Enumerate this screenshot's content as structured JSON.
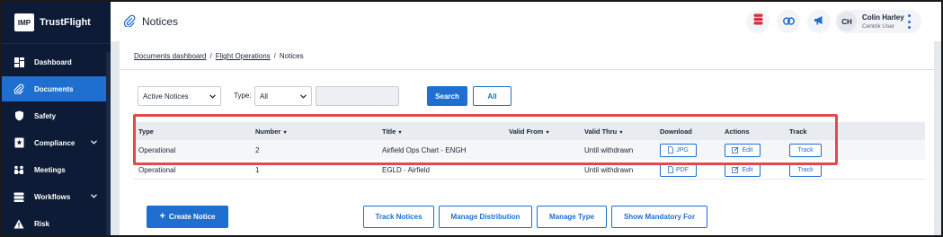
{
  "brand": {
    "logo_text": "IMP",
    "name": "TrustFlight"
  },
  "sidebar": {
    "items": [
      {
        "label": "Dashboard",
        "icon": "dashboard-icon"
      },
      {
        "label": "Documents",
        "icon": "paperclip-icon",
        "active": true
      },
      {
        "label": "Safety",
        "icon": "shield-icon"
      },
      {
        "label": "Compliance",
        "icon": "star-badge-icon",
        "has_submenu": true
      },
      {
        "label": "Meetings",
        "icon": "people-icon"
      },
      {
        "label": "Workflows",
        "icon": "stack-icon",
        "has_submenu": true
      },
      {
        "label": "Risk",
        "icon": "warning-icon"
      }
    ]
  },
  "header": {
    "title": "Notices",
    "title_icon": "paperclip-icon",
    "actions": [
      "database-icon",
      "link-icon",
      "megaphone-icon"
    ],
    "user": {
      "initials": "CH",
      "name": "Colin Harley",
      "role": "Centrik User"
    }
  },
  "breadcrumb": {
    "items": [
      "Documents dashboard",
      "Flight Operations"
    ],
    "current": "Notices",
    "separator": "/"
  },
  "filters": {
    "status_select": "Active Notices",
    "type_label": "Type:",
    "type_select": "All",
    "search_value": "",
    "search_button": "Search",
    "all_button": "All"
  },
  "table": {
    "columns": [
      {
        "label": "Type",
        "sortable": false
      },
      {
        "label": "Number",
        "sortable": true
      },
      {
        "label": "Title",
        "sortable": true
      },
      {
        "label": "Valid From",
        "sortable": true
      },
      {
        "label": "Valid Thru",
        "sortable": true
      },
      {
        "label": "Download",
        "sortable": false
      },
      {
        "label": "Actions",
        "sortable": false
      },
      {
        "label": "Track",
        "sortable": false
      }
    ],
    "rows": [
      {
        "type": "Operational",
        "number": "2",
        "title": "Airfield Ops Chart - ENGH",
        "valid_from": "",
        "valid_thru": "Until withdrawn",
        "download": "JPG",
        "action": "Edit",
        "track": "Track"
      },
      {
        "type": "Operational",
        "number": "1",
        "title": "EGLD - Airfield",
        "valid_from": "",
        "valid_thru": "Until withdrawn",
        "download": "PDF",
        "action": "Edit",
        "track": "Track"
      }
    ]
  },
  "footer_actions": {
    "create": "Create Notice",
    "track": "Track Notices",
    "distribution": "Manage Distribution",
    "type": "Manage Type",
    "mandatory": "Show Mandatory For"
  },
  "colors": {
    "sidebar_bg": "#0d1b36",
    "accent": "#1e6fcf",
    "highlight_border": "#e04a4a",
    "content_bg": "#e4e9ee"
  }
}
